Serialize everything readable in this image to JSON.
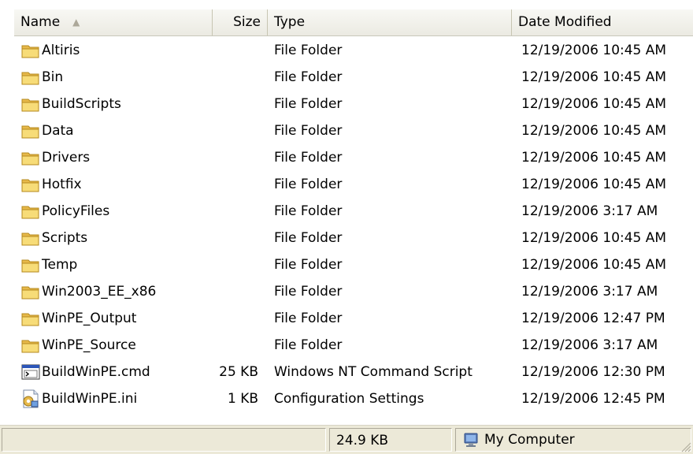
{
  "columns": {
    "name": "Name",
    "size": "Size",
    "type": "Type",
    "date": "Date Modified"
  },
  "sort": {
    "column": "name",
    "direction": "ascending",
    "icon": "sort-ascending-arrow-icon"
  },
  "rows": [
    {
      "name": "Altiris",
      "size": "",
      "type": "File Folder",
      "date": "12/19/2006 10:45 AM",
      "icon": "folder-icon"
    },
    {
      "name": "Bin",
      "size": "",
      "type": "File Folder",
      "date": "12/19/2006 10:45 AM",
      "icon": "folder-icon"
    },
    {
      "name": "BuildScripts",
      "size": "",
      "type": "File Folder",
      "date": "12/19/2006 10:45 AM",
      "icon": "folder-icon"
    },
    {
      "name": "Data",
      "size": "",
      "type": "File Folder",
      "date": "12/19/2006 10:45 AM",
      "icon": "folder-icon"
    },
    {
      "name": "Drivers",
      "size": "",
      "type": "File Folder",
      "date": "12/19/2006 10:45 AM",
      "icon": "folder-icon"
    },
    {
      "name": "Hotfix",
      "size": "",
      "type": "File Folder",
      "date": "12/19/2006 10:45 AM",
      "icon": "folder-icon"
    },
    {
      "name": "PolicyFiles",
      "size": "",
      "type": "File Folder",
      "date": "12/19/2006 3:17 AM",
      "icon": "folder-icon"
    },
    {
      "name": "Scripts",
      "size": "",
      "type": "File Folder",
      "date": "12/19/2006 10:45 AM",
      "icon": "folder-icon"
    },
    {
      "name": "Temp",
      "size": "",
      "type": "File Folder",
      "date": "12/19/2006 10:45 AM",
      "icon": "folder-icon"
    },
    {
      "name": "Win2003_EE_x86",
      "size": "",
      "type": "File Folder",
      "date": "12/19/2006 3:17 AM",
      "icon": "folder-icon"
    },
    {
      "name": "WinPE_Output",
      "size": "",
      "type": "File Folder",
      "date": "12/19/2006 12:47 PM",
      "icon": "folder-icon"
    },
    {
      "name": "WinPE_Source",
      "size": "",
      "type": "File Folder",
      "date": "12/19/2006 3:17 AM",
      "icon": "folder-icon"
    },
    {
      "name": "BuildWinPE.cmd",
      "size": "25 KB",
      "type": "Windows NT Command Script",
      "date": "12/19/2006 12:30 PM",
      "icon": "cmd-script-icon"
    },
    {
      "name": "BuildWinPE.ini",
      "size": "1 KB",
      "type": "Configuration Settings",
      "date": "12/19/2006 12:45 PM",
      "icon": "config-settings-icon"
    }
  ],
  "status": {
    "left": "",
    "size": "24.9 KB",
    "zone": "My Computer",
    "zone_icon": "my-computer-icon"
  },
  "colors": {
    "folder": "#f4d66c",
    "header_bg": "#ebeae2",
    "statusbar_bg": "#ece9d8"
  }
}
